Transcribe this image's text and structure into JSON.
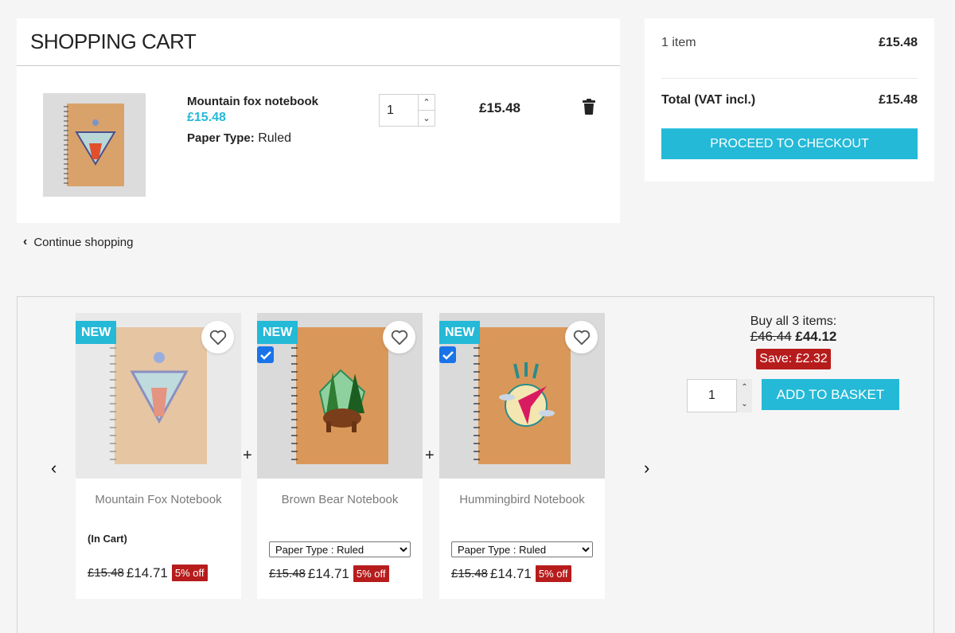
{
  "cart": {
    "title": "SHOPPING CART",
    "line": {
      "name": "Mountain fox notebook",
      "unit_price": "£15.48",
      "attribute_label": "Paper Type:",
      "attribute_value": "Ruled",
      "quantity": "1",
      "line_total": "£15.48"
    },
    "continue_label": "Continue shopping"
  },
  "summary": {
    "items_label": "1 item",
    "items_value": "£15.48",
    "total_label": "Total (VAT incl.)",
    "total_value": "£15.48",
    "checkout_label": "PROCEED TO CHECKOUT"
  },
  "bundle": {
    "prev_label": "‹",
    "next_label": "›",
    "plus_symbol": "+",
    "products": [
      {
        "badge": "NEW",
        "name": "Mountain Fox Notebook",
        "status": "(In Cart)",
        "old_price": "£15.48",
        "new_price": "£14.71",
        "discount": "5% off",
        "checked": null
      },
      {
        "badge": "NEW",
        "name": "Brown Bear Notebook",
        "variant": "Paper Type : Ruled",
        "old_price": "£15.48",
        "new_price": "£14.71",
        "discount": "5% off",
        "checked": true
      },
      {
        "badge": "NEW",
        "name": "Hummingbird Notebook",
        "variant": "Paper Type : Ruled",
        "old_price": "£15.48",
        "new_price": "£14.71",
        "discount": "5% off",
        "checked": true
      }
    ],
    "buy_all_label": "Buy all 3 items:",
    "old_total": "£46.44",
    "new_total": "£44.12",
    "save_label": "Save: £2.32",
    "quantity": "1",
    "add_label": "ADD TO BASKET"
  },
  "colors": {
    "accent": "#24b9d7",
    "discount": "#b71c1c",
    "checkbox": "#1a73e8"
  }
}
